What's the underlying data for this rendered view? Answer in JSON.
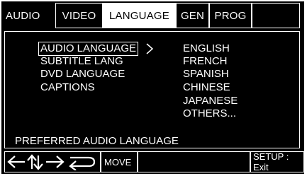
{
  "tabs": [
    {
      "label": "AUDIO"
    },
    {
      "label": "VIDEO"
    },
    {
      "label": "LANGUAGE"
    },
    {
      "label": "GEN"
    },
    {
      "label": "PROG"
    }
  ],
  "menu": {
    "items": [
      {
        "label": "AUDIO LANGUAGE"
      },
      {
        "label": "SUBTITLE LANG"
      },
      {
        "label": "DVD LANGUAGE"
      },
      {
        "label": "CAPTIONS"
      }
    ]
  },
  "options": [
    "ENGLISH",
    "FRENCH",
    "SPANISH",
    "CHINESE",
    "JAPANESE",
    "OTHERS..."
  ],
  "help_text": "PREFERRED AUDIO LANGUAGE",
  "bottom": {
    "nav_icons": [
      "left-arrow-icon",
      "up-arrow-icon",
      "down-arrow-icon",
      "right-arrow-icon",
      "enter-icon"
    ],
    "move_label": "MOVE",
    "exit_label": "SETUP : Exit"
  },
  "colors": {
    "background": "#000000",
    "foreground": "#ffffff"
  }
}
